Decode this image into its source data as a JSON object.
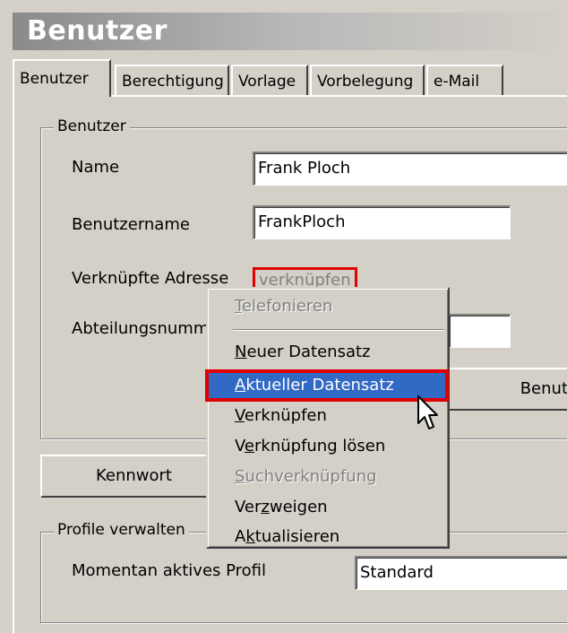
{
  "window": {
    "title": "Benutzer"
  },
  "tabs": [
    {
      "label": "Benutzer"
    },
    {
      "label": "Berechtigung"
    },
    {
      "label": "Vorlage"
    },
    {
      "label": "Vorbelegung"
    },
    {
      "label": "e-Mail"
    }
  ],
  "group_user": {
    "title": "Benutzer",
    "name_label": "Name",
    "name_value": "Frank Ploch",
    "username_label": "Benutzername",
    "username_value": "FrankPloch",
    "address_label": "Verknüpfte Adresse",
    "link_button": "verknüpfen",
    "department_label": "Abteilungsnumm",
    "department_value": "",
    "right_button": "Benut"
  },
  "password_button": "Kennwort",
  "group_profiles": {
    "title": "Profile verwalten",
    "active_profile_label": "Momentan aktives Profil",
    "active_profile_value": "Standard"
  },
  "context_menu": {
    "items": [
      {
        "label": "Telefonieren",
        "mnemonic": "T",
        "enabled": false
      },
      {
        "label": "Neuer Datensatz",
        "mnemonic": "N",
        "enabled": true
      },
      {
        "label": "Aktueller Datensatz",
        "mnemonic": "A",
        "enabled": true,
        "highlighted": true
      },
      {
        "label": "Verknüpfen",
        "mnemonic": "V",
        "enabled": true
      },
      {
        "label": "Verknüpfung lösen",
        "mnemonic": "e",
        "enabled": true
      },
      {
        "label": "Suchverknüpfung",
        "mnemonic": "S",
        "enabled": false
      },
      {
        "label": "Verzweigen",
        "mnemonic": "z",
        "enabled": true
      },
      {
        "label": "Aktualisieren",
        "mnemonic": "k",
        "enabled": true
      }
    ]
  },
  "colors": {
    "highlight": "#316ac5",
    "annotation": "#e00000",
    "face": "#d4d0c8"
  }
}
